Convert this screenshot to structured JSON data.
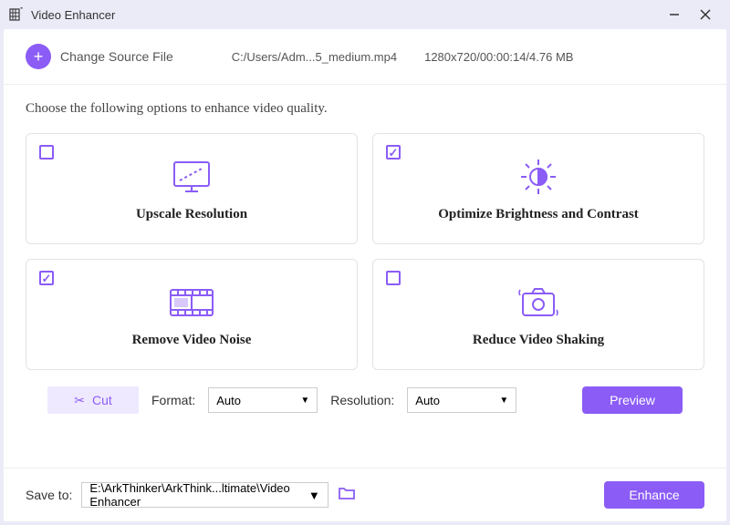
{
  "titlebar": {
    "title": "Video Enhancer"
  },
  "source": {
    "change_label": "Change Source File",
    "path": "C:/Users/Adm...5_medium.mp4",
    "meta": "1280x720/00:00:14/4.76 MB"
  },
  "instructions": "Choose the following options to enhance video quality.",
  "options": {
    "upscale": {
      "label": "Upscale Resolution",
      "checked": false
    },
    "brightness": {
      "label": "Optimize Brightness and Contrast",
      "checked": true
    },
    "noise": {
      "label": "Remove Video Noise",
      "checked": true
    },
    "shaking": {
      "label": "Reduce Video Shaking",
      "checked": false
    }
  },
  "controls": {
    "cut": "Cut",
    "format_label": "Format:",
    "format_value": "Auto",
    "resolution_label": "Resolution:",
    "resolution_value": "Auto",
    "preview": "Preview"
  },
  "save": {
    "label": "Save to:",
    "path": "E:\\ArkThinker\\ArkThink...ltimate\\Video Enhancer",
    "enhance": "Enhance"
  }
}
